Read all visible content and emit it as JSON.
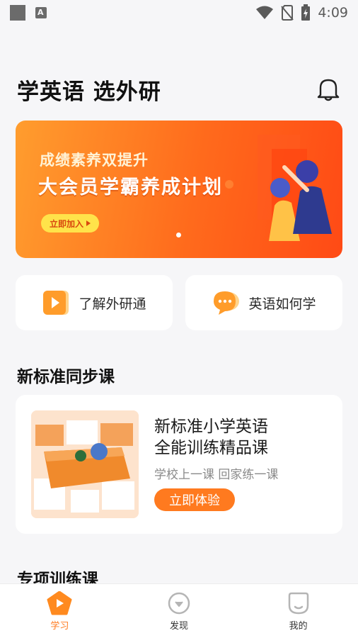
{
  "status_bar": {
    "time": "4:09"
  },
  "header": {
    "title": "学英语 选外研"
  },
  "banner": {
    "subtitle": "成绩素养双提升",
    "headline": "大会员学霸养成计划",
    "button_label": "立即加入"
  },
  "quick_links": [
    {
      "label": "了解外研通",
      "icon": "video-play-icon"
    },
    {
      "label": "英语如何学",
      "icon": "chat-bubble-icon"
    }
  ],
  "sections": {
    "sync_course_title": "新标准同步课",
    "special_training_title": "专项训练课"
  },
  "course": {
    "title_line1": "新标准小学英语",
    "title_line2": "全能训练精品课",
    "subtitle": "学校上一课 回家练一课",
    "button_label": "立即体验"
  },
  "bottom_nav": [
    {
      "label": "学习",
      "active": true
    },
    {
      "label": "发现",
      "active": false
    },
    {
      "label": "我的",
      "active": false
    }
  ],
  "colors": {
    "accent": "#ff7a1f",
    "banner_start": "#ff9d2e",
    "banner_end": "#ff4a15"
  }
}
